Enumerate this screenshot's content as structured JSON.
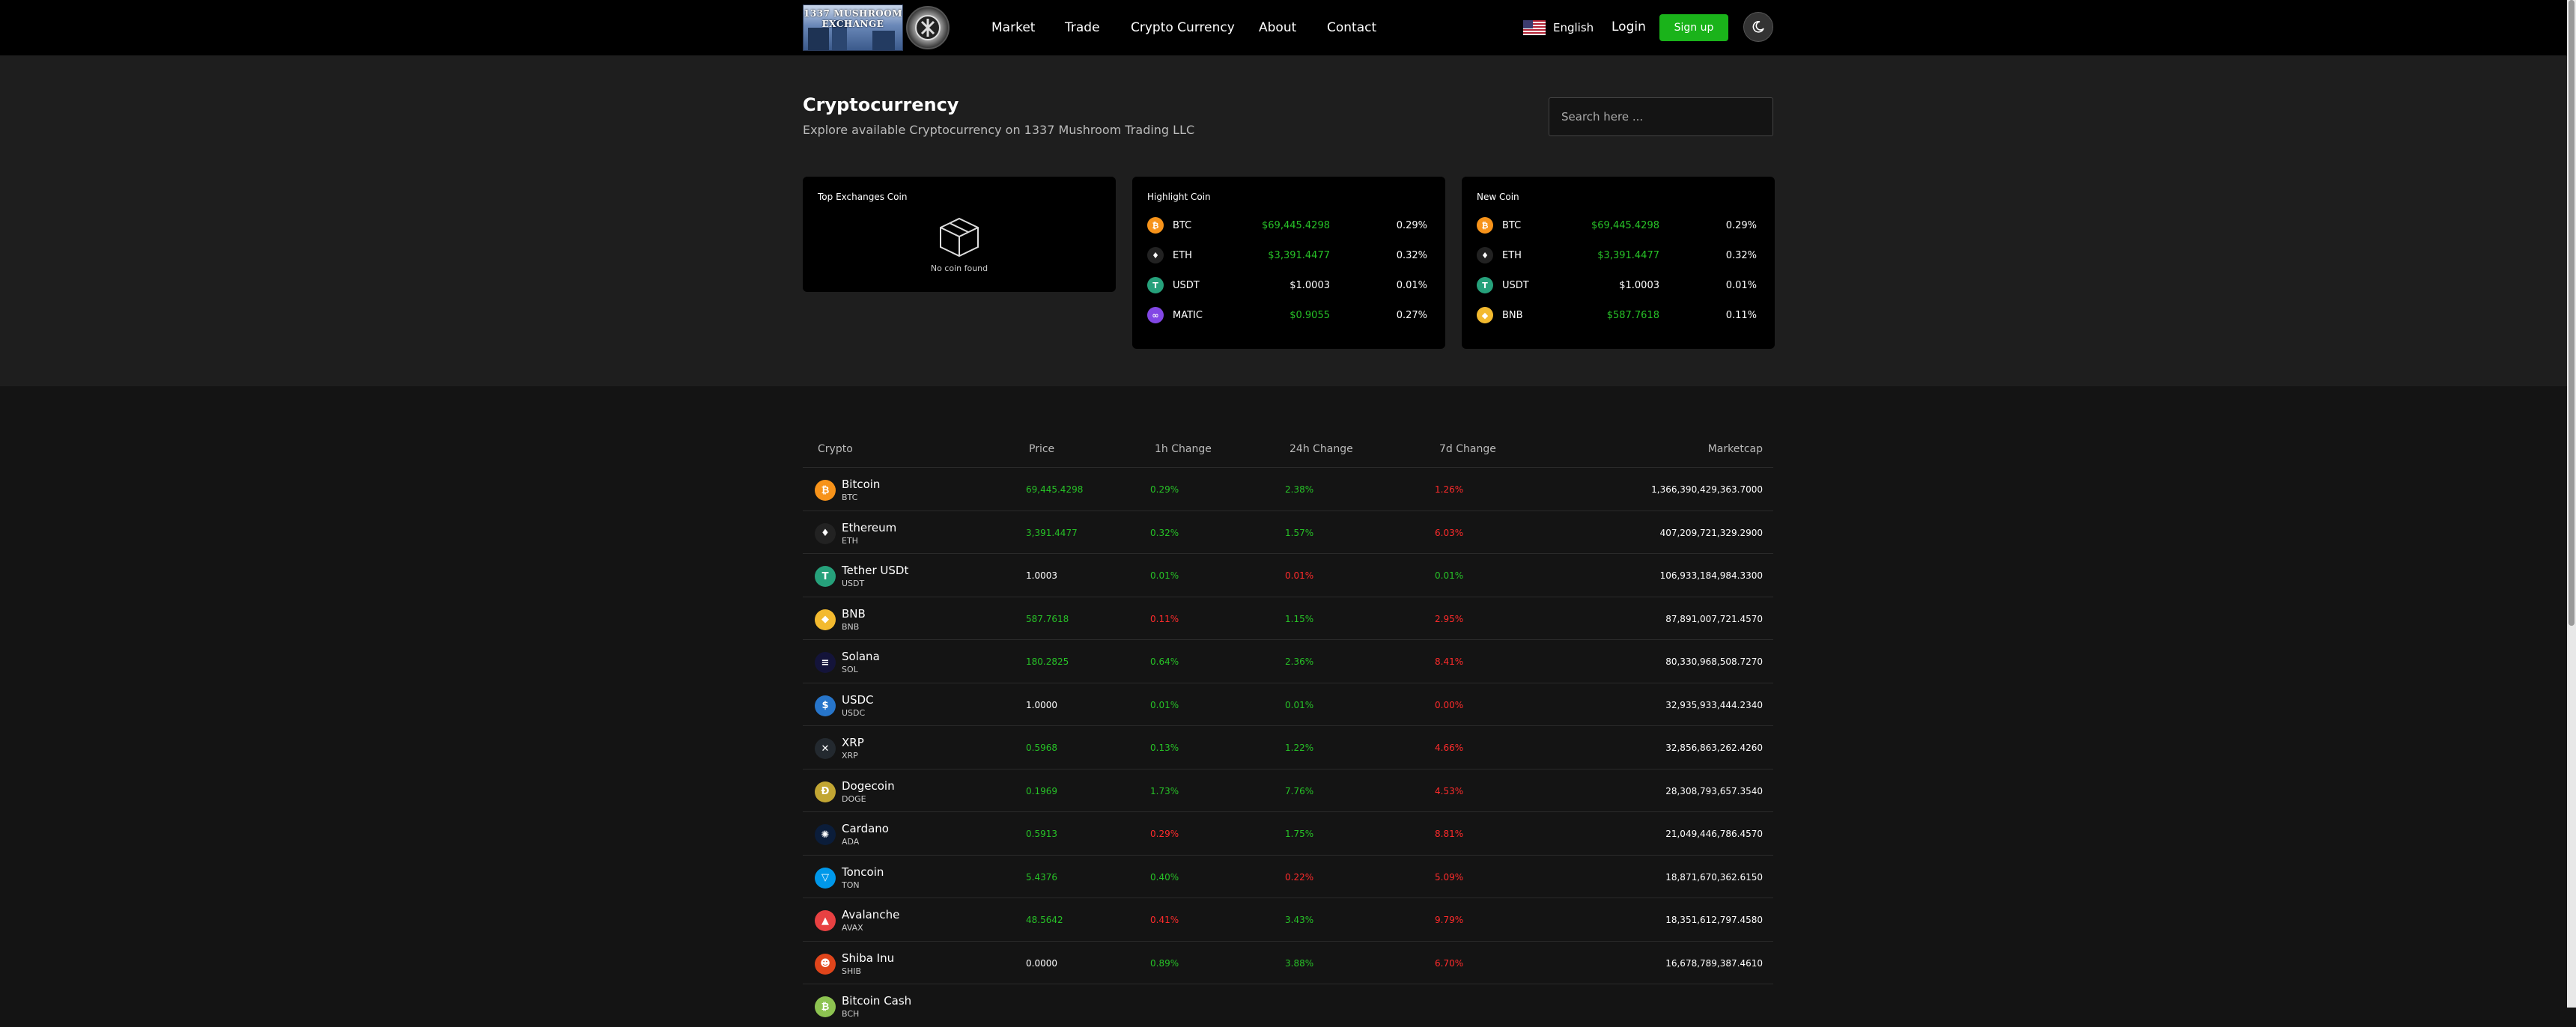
{
  "header": {
    "logo_text": "1337 MUSHROOM EXCHANGE",
    "nav": [
      "Market",
      "Trade",
      "Crypto Currency",
      "About",
      "Contact"
    ],
    "language": "English",
    "login": "Login",
    "signup": "Sign up"
  },
  "hero": {
    "title": "Cryptocurrency",
    "subtitle": "Explore available Cryptocurrency on 1337 Mushroom Trading LLC",
    "search_placeholder": "Search here ..."
  },
  "cards": {
    "top": {
      "title": "Top Exchanges Coin",
      "empty": "No coin found"
    },
    "highlight": {
      "title": "Highlight Coin",
      "rows": [
        {
          "symbol": "BTC",
          "price": "$69,445.4298",
          "change": "0.29%",
          "price_color": "#27c227",
          "icon_color": "#f7931a",
          "icon": "₿"
        },
        {
          "symbol": "ETH",
          "price": "$3,391.4477",
          "change": "0.32%",
          "price_color": "#27c227",
          "icon_color": "#222222",
          "icon": "♦"
        },
        {
          "symbol": "USDT",
          "price": "$1.0003",
          "change": "0.01%",
          "price_color": "#ffffff",
          "icon_color": "#26a17b",
          "icon": "T"
        },
        {
          "symbol": "MATIC",
          "price": "$0.9055",
          "change": "0.27%",
          "price_color": "#27c227",
          "icon_color": "#8247e5",
          "icon": "∞"
        }
      ]
    },
    "newcoin": {
      "title": "New Coin",
      "rows": [
        {
          "symbol": "BTC",
          "price": "$69,445.4298",
          "change": "0.29%",
          "price_color": "#27c227",
          "icon_color": "#f7931a",
          "icon": "₿"
        },
        {
          "symbol": "ETH",
          "price": "$3,391.4477",
          "change": "0.32%",
          "price_color": "#27c227",
          "icon_color": "#222222",
          "icon": "♦"
        },
        {
          "symbol": "USDT",
          "price": "$1.0003",
          "change": "0.01%",
          "price_color": "#ffffff",
          "icon_color": "#26a17b",
          "icon": "T"
        },
        {
          "symbol": "BNB",
          "price": "$587.7618",
          "change": "0.11%",
          "price_color": "#27c227",
          "icon_color": "#f3ba2f",
          "icon": "◆"
        }
      ]
    }
  },
  "table": {
    "headers": [
      "Crypto",
      "Price",
      "1h Change",
      "24h Change",
      "7d Change",
      "Marketcap"
    ],
    "rows": [
      {
        "name": "Bitcoin",
        "symbol": "BTC",
        "price": "69,445.4298",
        "h1": "0.29%",
        "h24": "2.38%",
        "d7": "1.26%",
        "mcap": "1,366,390,429,363.7000",
        "pc": "g",
        "c1": "g",
        "c24": "g",
        "c7": "r",
        "icon_color": "#f7931a",
        "icon": "₿"
      },
      {
        "name": "Ethereum",
        "symbol": "ETH",
        "price": "3,391.4477",
        "h1": "0.32%",
        "h24": "1.57%",
        "d7": "6.03%",
        "mcap": "407,209,721,329.2900",
        "pc": "g",
        "c1": "g",
        "c24": "g",
        "c7": "r",
        "icon_color": "#222222",
        "icon": "♦"
      },
      {
        "name": "Tether USDt",
        "symbol": "USDT",
        "price": "1.0003",
        "h1": "0.01%",
        "h24": "0.01%",
        "d7": "0.01%",
        "mcap": "106,933,184,984.3300",
        "pc": "w",
        "c1": "g",
        "c24": "r",
        "c7": "g",
        "icon_color": "#26a17b",
        "icon": "T"
      },
      {
        "name": "BNB",
        "symbol": "BNB",
        "price": "587.7618",
        "h1": "0.11%",
        "h24": "1.15%",
        "d7": "2.95%",
        "mcap": "87,891,007,721.4570",
        "pc": "g",
        "c1": "r",
        "c24": "g",
        "c7": "r",
        "icon_color": "#f3ba2f",
        "icon": "◆"
      },
      {
        "name": "Solana",
        "symbol": "SOL",
        "price": "180.2825",
        "h1": "0.64%",
        "h24": "2.36%",
        "d7": "8.41%",
        "mcap": "80,330,968,508.7270",
        "pc": "g",
        "c1": "g",
        "c24": "g",
        "c7": "r",
        "icon_color": "#14143a",
        "icon": "≡"
      },
      {
        "name": "USDC",
        "symbol": "USDC",
        "price": "1.0000",
        "h1": "0.01%",
        "h24": "0.01%",
        "d7": "0.00%",
        "mcap": "32,935,933,444.2340",
        "pc": "w",
        "c1": "g",
        "c24": "g",
        "c7": "r",
        "icon_color": "#2775ca",
        "icon": "$"
      },
      {
        "name": "XRP",
        "symbol": "XRP",
        "price": "0.5968",
        "h1": "0.13%",
        "h24": "1.22%",
        "d7": "4.66%",
        "mcap": "32,856,863,262.4260",
        "pc": "g",
        "c1": "g",
        "c24": "g",
        "c7": "r",
        "icon_color": "#23292f",
        "icon": "✕"
      },
      {
        "name": "Dogecoin",
        "symbol": "DOGE",
        "price": "0.1969",
        "h1": "1.73%",
        "h24": "7.76%",
        "d7": "4.53%",
        "mcap": "28,308,793,657.3540",
        "pc": "g",
        "c1": "g",
        "c24": "g",
        "c7": "r",
        "icon_color": "#c2a633",
        "icon": "Ð"
      },
      {
        "name": "Cardano",
        "symbol": "ADA",
        "price": "0.5913",
        "h1": "0.29%",
        "h24": "1.75%",
        "d7": "8.81%",
        "mcap": "21,049,446,786.4570",
        "pc": "g",
        "c1": "r",
        "c24": "g",
        "c7": "r",
        "icon_color": "#0b1d3a",
        "icon": "✺"
      },
      {
        "name": "Toncoin",
        "symbol": "TON",
        "price": "5.4376",
        "h1": "0.40%",
        "h24": "0.22%",
        "d7": "5.09%",
        "mcap": "18,871,670,362.6150",
        "pc": "g",
        "c1": "g",
        "c24": "r",
        "c7": "r",
        "icon_color": "#0098ea",
        "icon": "▽"
      },
      {
        "name": "Avalanche",
        "symbol": "AVAX",
        "price": "48.5642",
        "h1": "0.41%",
        "h24": "3.43%",
        "d7": "9.79%",
        "mcap": "18,351,612,797.4580",
        "pc": "g",
        "c1": "r",
        "c24": "g",
        "c7": "r",
        "icon_color": "#e84142",
        "icon": "▲"
      },
      {
        "name": "Shiba Inu",
        "symbol": "SHIB",
        "price": "0.0000",
        "h1": "0.89%",
        "h24": "3.88%",
        "d7": "6.70%",
        "mcap": "16,678,789,387.4610",
        "pc": "w",
        "c1": "g",
        "c24": "g",
        "c7": "r",
        "icon_color": "#e0451b",
        "icon": "☻"
      },
      {
        "name": "Bitcoin Cash",
        "symbol": "BCH",
        "price": "",
        "h1": "",
        "h24": "",
        "d7": "",
        "mcap": "",
        "pc": "r",
        "c1": "r",
        "c24": "r",
        "c7": "r",
        "icon_color": "#8dc351",
        "icon": "₿"
      }
    ]
  }
}
